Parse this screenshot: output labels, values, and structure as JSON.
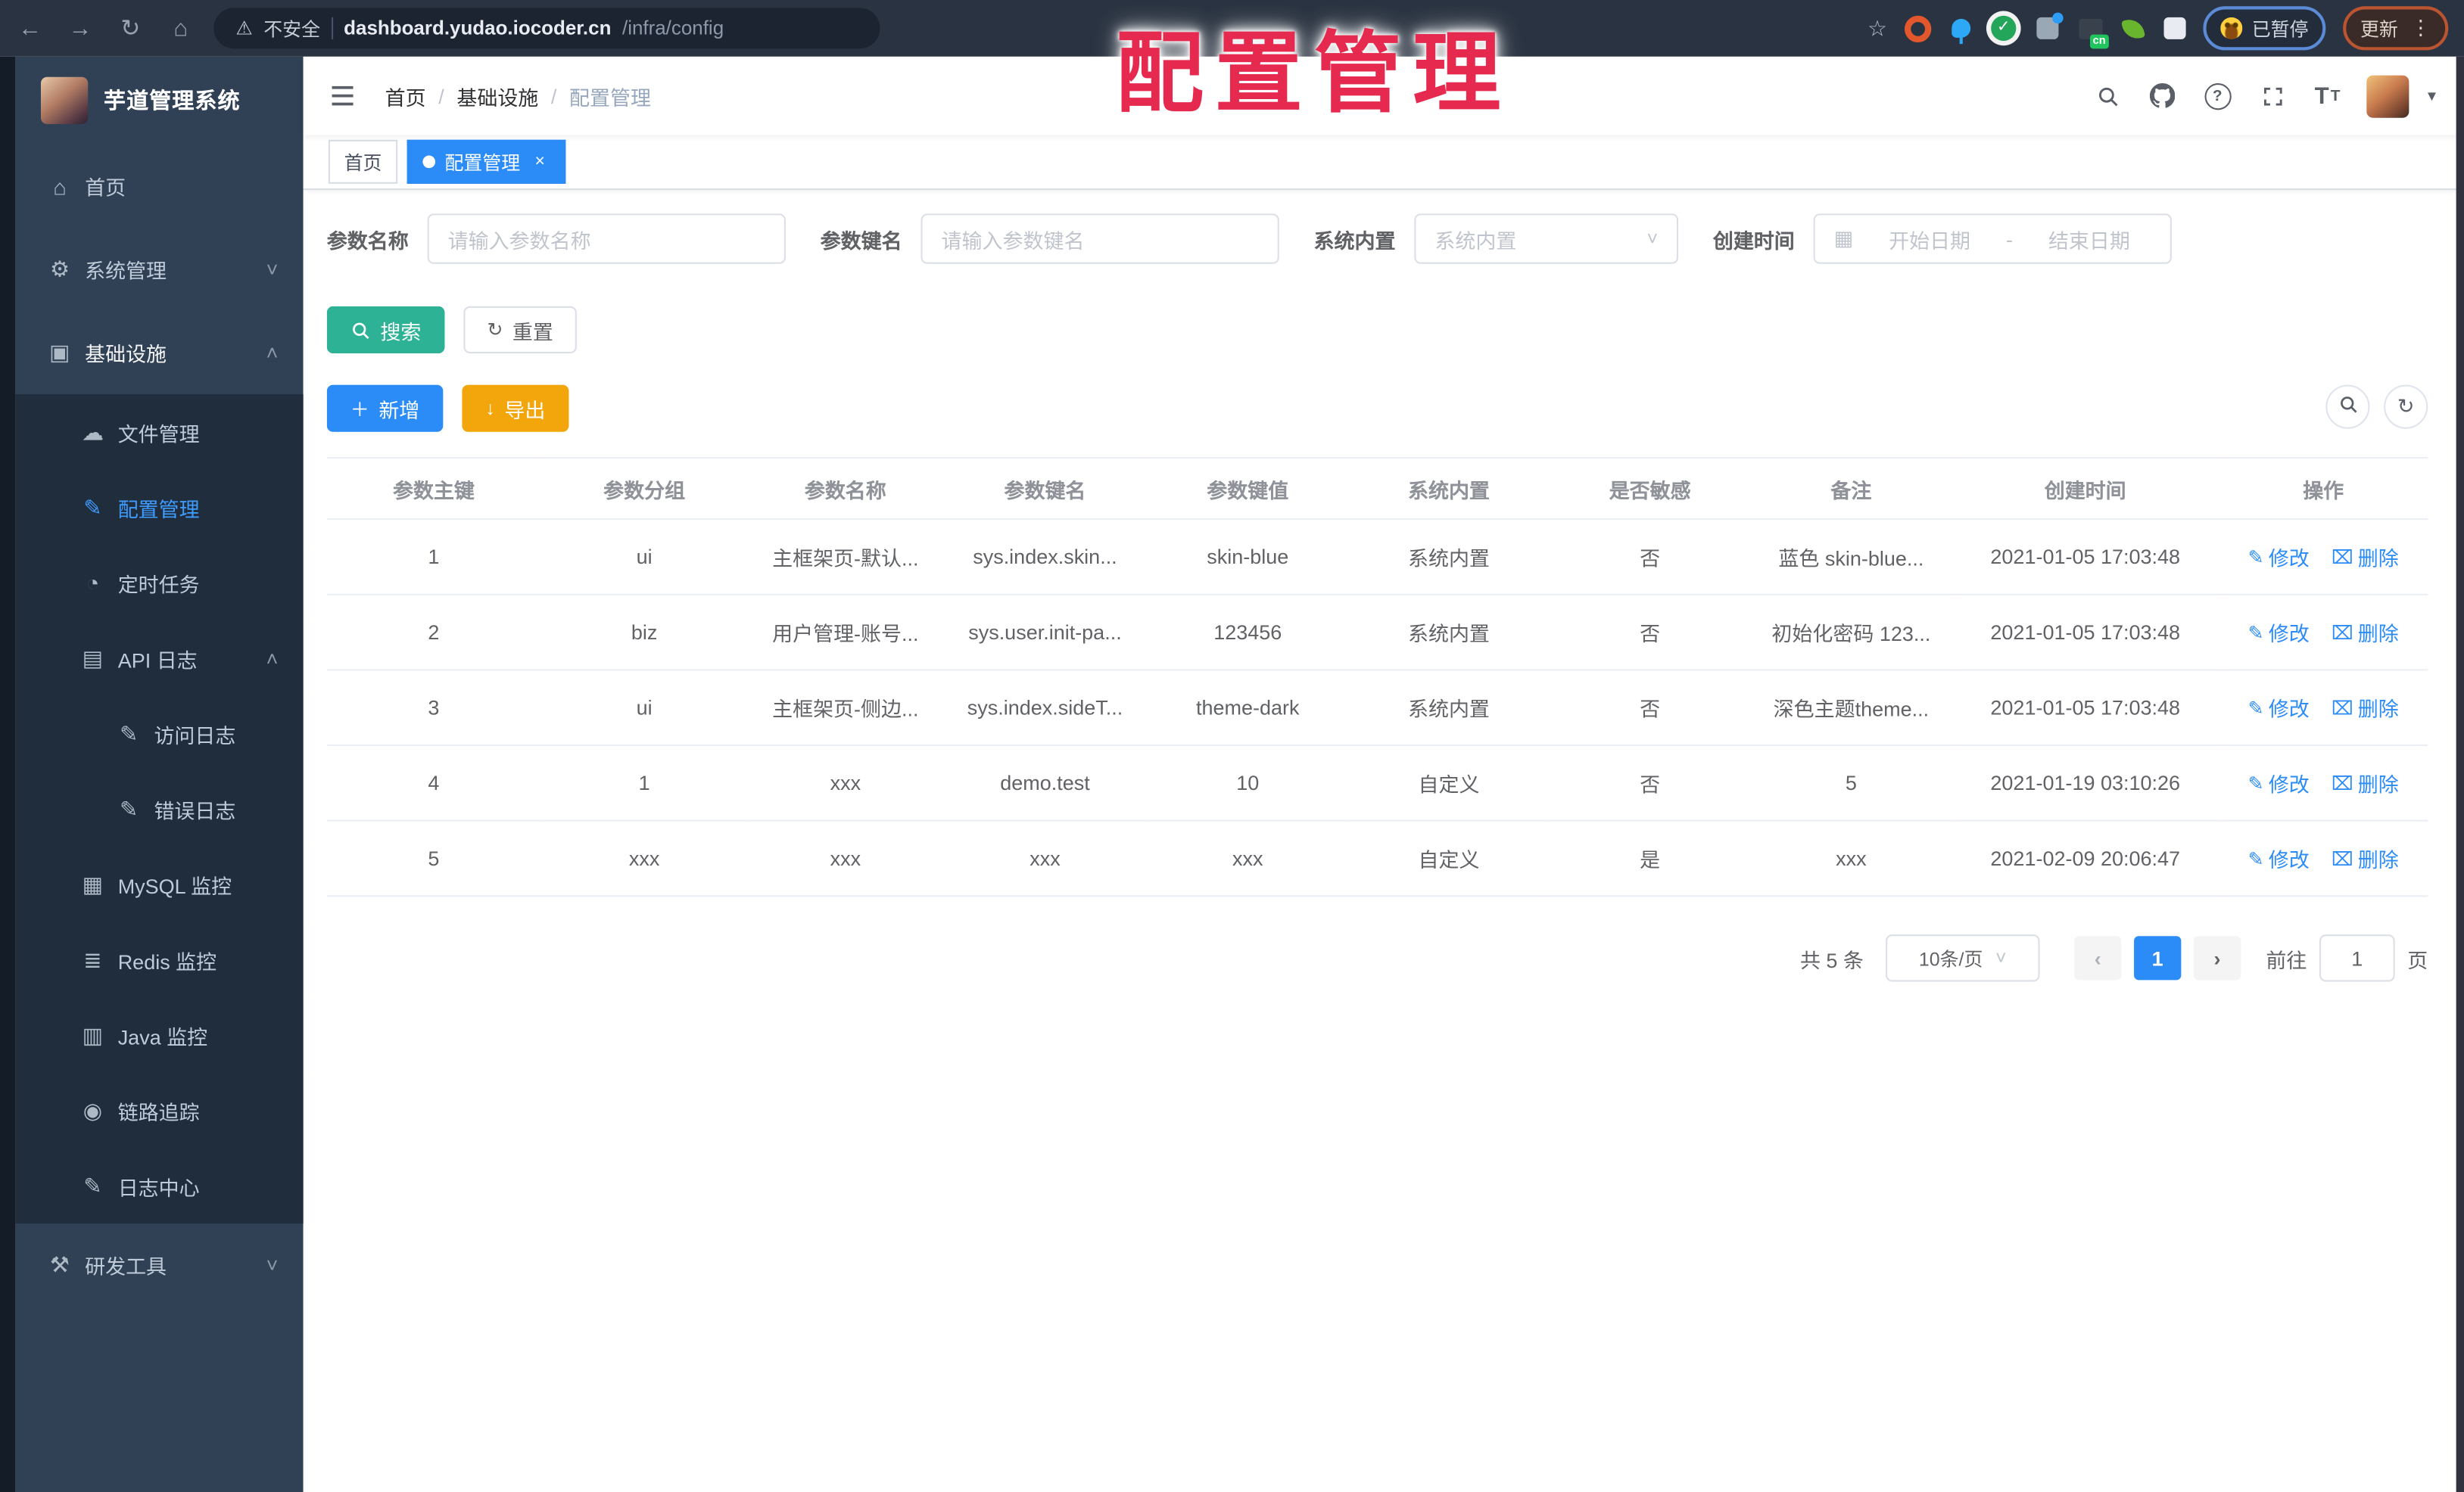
{
  "accent": "#2b8cf8",
  "watermark_text": "配置管理",
  "browser": {
    "nav_icons": [
      "back-icon",
      "forward-icon",
      "reload-icon",
      "home-icon"
    ],
    "warning_icon": "warning-icon",
    "security_label": "不安全",
    "url_host": "dashboard.yudao.iocoder.cn",
    "url_path": "/infra/config",
    "bookmark_icon": "star-icon",
    "extensions": [
      {
        "name": "orange-ring-extension-icon"
      },
      {
        "name": "blue-pin-extension-icon"
      },
      {
        "name": "green-check-extension-icon"
      },
      {
        "name": "gray-blue-extension-icon"
      },
      {
        "name": "cn-badge-extension-icon",
        "badge": "cn"
      },
      {
        "name": "green-leaf-extension-icon"
      },
      {
        "name": "puzzle-extensions-icon"
      }
    ],
    "paused_badge": "已暂停",
    "update_button": "更新"
  },
  "sidebar": {
    "app_title": "芋道管理系统",
    "menu": [
      {
        "label": "首页",
        "icon": "home-icon",
        "level": 1
      },
      {
        "label": "系统管理",
        "icon": "gear-icon",
        "level": 1,
        "chevron": "down"
      },
      {
        "label": "基础设施",
        "icon": "monitor-icon",
        "level": 1,
        "chevron": "up",
        "highlight": true
      },
      {
        "label": "文件管理",
        "icon": "cloud-upload-icon",
        "level": 2
      },
      {
        "label": "配置管理",
        "icon": "edit-square-icon",
        "level": 2,
        "active": true
      },
      {
        "label": "定时任务",
        "icon": "timer-icon",
        "level": 2
      },
      {
        "label": "API 日志",
        "icon": "log-icon",
        "level": 2,
        "chevron": "up"
      },
      {
        "label": "访问日志",
        "icon": "access-log-icon",
        "level": 3
      },
      {
        "label": "错误日志",
        "icon": "error-log-icon",
        "level": 3
      },
      {
        "label": "MySQL 监控",
        "icon": "mysql-icon",
        "level": 2
      },
      {
        "label": "Redis 监控",
        "icon": "redis-icon",
        "level": 2
      },
      {
        "label": "Java 监控",
        "icon": "java-icon",
        "level": 2
      },
      {
        "label": "链路追踪",
        "icon": "trace-eye-icon",
        "level": 2
      },
      {
        "label": "日志中心",
        "icon": "log-center-icon",
        "level": 2
      },
      {
        "label": "研发工具",
        "icon": "toolbox-icon",
        "level": 1,
        "chevron": "down"
      }
    ]
  },
  "navbar": {
    "breadcrumb": [
      {
        "label": "首页"
      },
      {
        "label": "基础设施"
      },
      {
        "label": "配置管理",
        "current": true
      }
    ],
    "separator": "/",
    "icons": [
      "search-icon",
      "github-icon",
      "help-icon",
      "fullscreen-icon",
      "font-size-icon"
    ]
  },
  "tabs": [
    {
      "label": "首页"
    },
    {
      "label": "配置管理",
      "active": true,
      "closable": true
    }
  ],
  "filters": {
    "name": {
      "label": "参数名称",
      "placeholder": "请输入参数名称"
    },
    "key": {
      "label": "参数键名",
      "placeholder": "请输入参数键名"
    },
    "type": {
      "label": "系统内置",
      "placeholder": "系统内置"
    },
    "date": {
      "label": "创建时间",
      "icon": "calendar-icon",
      "start_placeholder": "开始日期",
      "separator": "-",
      "end_placeholder": "结束日期"
    }
  },
  "actions": {
    "search": "搜索",
    "reset": "重置",
    "add": "新增",
    "export": "导出"
  },
  "toolbar_buttons": [
    "search-toggle-icon",
    "refresh-icon"
  ],
  "table": {
    "headers": [
      "参数主键",
      "参数分组",
      "参数名称",
      "参数键名",
      "参数键值",
      "系统内置",
      "是否敏感",
      "备注",
      "创建时间",
      "操作"
    ],
    "rows": [
      {
        "cells": [
          "1",
          "ui",
          "主框架页-默认...",
          "sys.index.skin...",
          "skin-blue",
          "系统内置",
          "否",
          "蓝色 skin-blue...",
          "2021-01-05 17:03:48"
        ]
      },
      {
        "cells": [
          "2",
          "biz",
          "用户管理-账号...",
          "sys.user.init-pa...",
          "123456",
          "系统内置",
          "否",
          "初始化密码 123...",
          "2021-01-05 17:03:48"
        ]
      },
      {
        "cells": [
          "3",
          "ui",
          "主框架页-侧边...",
          "sys.index.sideT...",
          "theme-dark",
          "系统内置",
          "否",
          "深色主题theme...",
          "2021-01-05 17:03:48"
        ]
      },
      {
        "cells": [
          "4",
          "1",
          "xxx",
          "demo.test",
          "10",
          "自定义",
          "否",
          "5",
          "2021-01-19 03:10:26"
        ]
      },
      {
        "cells": [
          "5",
          "xxx",
          "xxx",
          "xxx",
          "xxx",
          "自定义",
          "是",
          "xxx",
          "2021-02-09 20:06:47"
        ]
      }
    ],
    "row_actions": {
      "edit": "修改",
      "delete": "删除"
    }
  },
  "pagination": {
    "total_text": "共 5 条",
    "page_size": "10条/页",
    "current_page": "1",
    "goto_label": "前往",
    "goto_value": "1",
    "page_unit": "页"
  }
}
